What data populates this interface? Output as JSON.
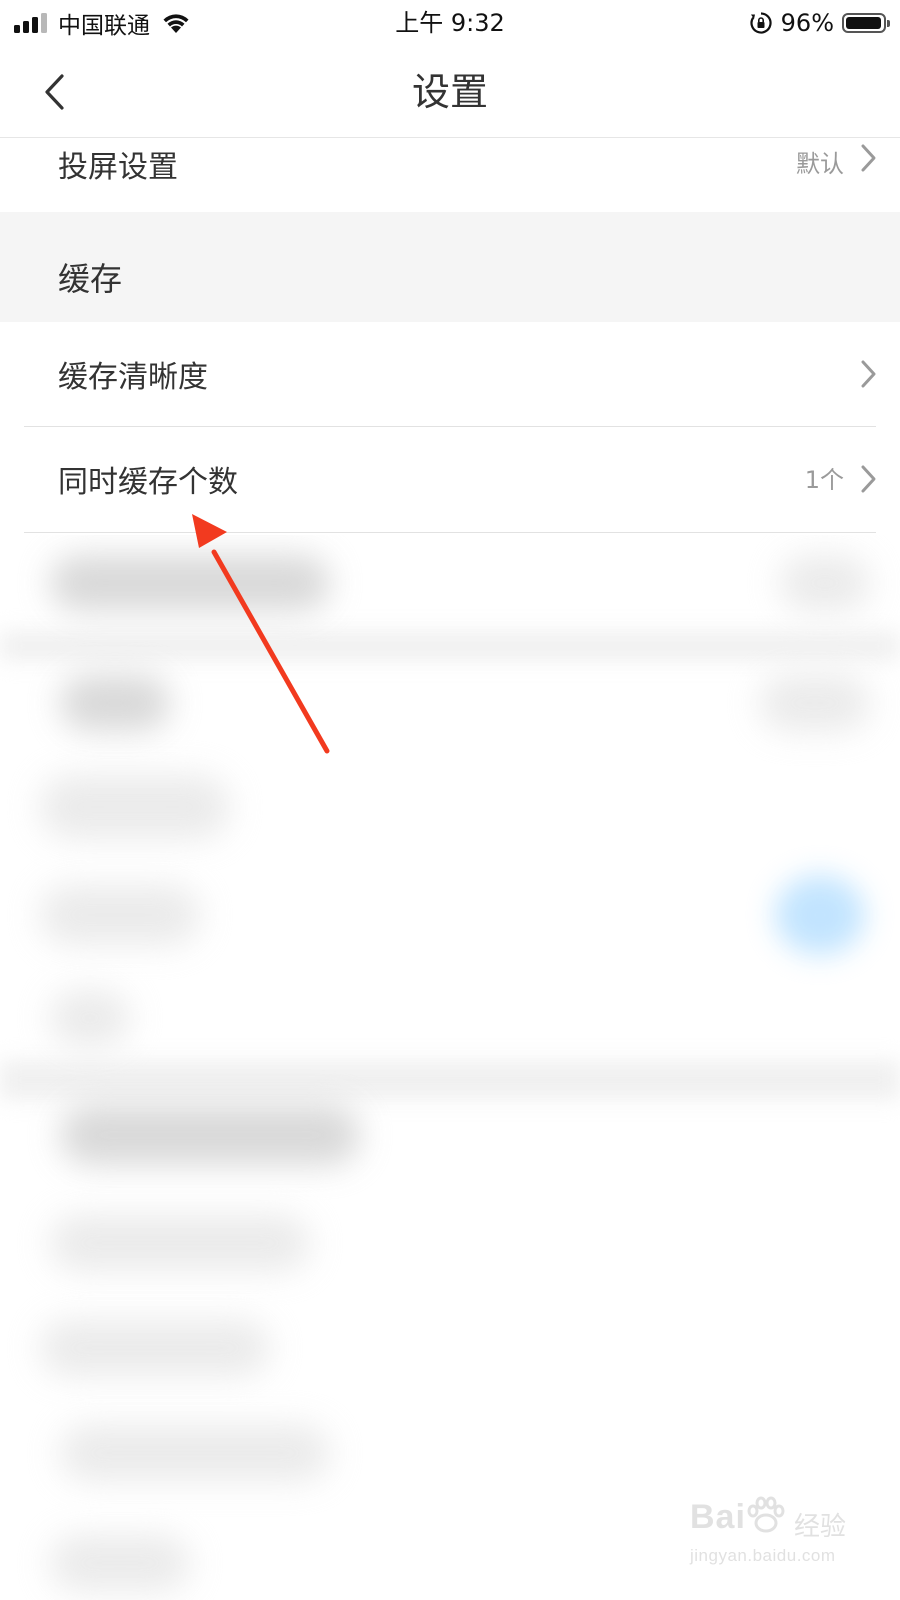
{
  "status_bar": {
    "carrier": "中国联通",
    "time": "上午 9:32",
    "battery_percent": "96%",
    "battery_level": 0.96,
    "signal_bars_filled": 3,
    "signal_bars_total": 4,
    "icons": [
      "signal-icon",
      "wifi-icon",
      "orientation-lock-icon",
      "battery-icon"
    ]
  },
  "nav": {
    "title": "设置",
    "back_icon": "chevron-left-icon"
  },
  "rows_top": {
    "cast": {
      "label": "投屏设置",
      "value": "默认"
    }
  },
  "section": {
    "title": "缓存"
  },
  "cache_rows": [
    {
      "label": "缓存清晰度",
      "value": ""
    },
    {
      "label": "同时缓存个数",
      "value": "1个"
    }
  ],
  "annotation": {
    "arrow_color": "#f23a1f"
  },
  "watermark": {
    "brand": "Bai",
    "brand_suffix": "经验",
    "url": "jingyan.baidu.com"
  },
  "colors": {
    "text_primary": "#333333",
    "text_secondary": "#9a9a9a",
    "section_bg": "#f5f5f5",
    "divider": "#e2e2e2"
  }
}
